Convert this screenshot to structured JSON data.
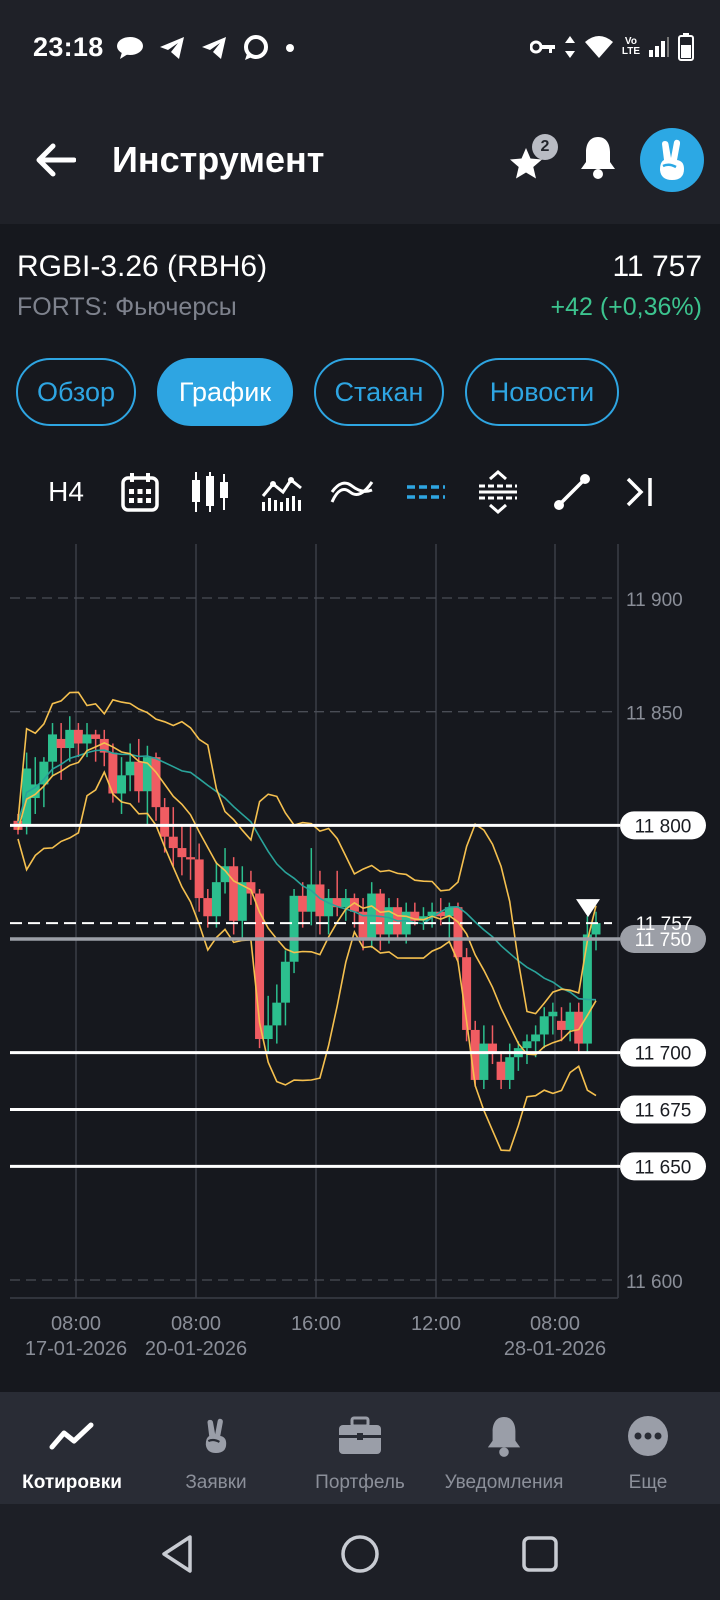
{
  "status_bar": {
    "time": "23:18",
    "volte_top": "Vo",
    "volte_bottom": "LTE"
  },
  "app_bar": {
    "title": "Инструмент",
    "favorites_count": "2"
  },
  "instrument": {
    "name": "RGBI-3.26 (RBH6)",
    "price": "11 757",
    "exchange": "FORTS: Фьючерсы",
    "change": "+42 (+0,36%)"
  },
  "tabs": [
    {
      "label": "Обзор",
      "active": false
    },
    {
      "label": "График",
      "active": true
    },
    {
      "label": "Стакан",
      "active": false
    },
    {
      "label": "Новости",
      "active": false
    }
  ],
  "toolbar": {
    "timeframe": "H4"
  },
  "colors": {
    "accent": "#2ea5e2",
    "bull": "#2cbf8e",
    "bear": "#f05c62",
    "bollinger": "#f5c04f",
    "moving_average": "#2aa49b",
    "positive": "#3cc48f"
  },
  "chart_data": {
    "type": "candlestick",
    "ylim": [
      11590,
      11920
    ],
    "y_ticks": [
      11900,
      11850,
      11600
    ],
    "x_tick_labels": [
      {
        "time": "08:00",
        "date": "17-01-2026"
      },
      {
        "time": "08:00",
        "date": "20-01-2026"
      },
      {
        "time": "16:00",
        "date": ""
      },
      {
        "time": "12:00",
        "date": ""
      },
      {
        "time": "08:00",
        "date": "28-01-2026"
      }
    ],
    "horizontal_levels": [
      11800,
      11700,
      11675,
      11650
    ],
    "current_price": 11757,
    "selected_level": 11750,
    "candles": [
      [
        11802,
        11805,
        11796,
        11798
      ],
      [
        11800,
        11832,
        11796,
        11825
      ],
      [
        11812,
        11830,
        11805,
        11818
      ],
      [
        11818,
        11830,
        11808,
        11828
      ],
      [
        11828,
        11845,
        11822,
        11840
      ],
      [
        11838,
        11845,
        11820,
        11834
      ],
      [
        11834,
        11848,
        11828,
        11842
      ],
      [
        11842,
        11845,
        11830,
        11836
      ],
      [
        11836,
        11845,
        11830,
        11840
      ],
      [
        11840,
        11842,
        11828,
        11838
      ],
      [
        11838,
        11842,
        11826,
        11832
      ],
      [
        11832,
        11836,
        11810,
        11814
      ],
      [
        11814,
        11830,
        11805,
        11822
      ],
      [
        11822,
        11836,
        11815,
        11828
      ],
      [
        11828,
        11838,
        11810,
        11815
      ],
      [
        11815,
        11835,
        11800,
        11830
      ],
      [
        11830,
        11832,
        11802,
        11808
      ],
      [
        11808,
        11812,
        11788,
        11795
      ],
      [
        11795,
        11808,
        11782,
        11790
      ],
      [
        11790,
        11800,
        11778,
        11786
      ],
      [
        11786,
        11800,
        11776,
        11785
      ],
      [
        11785,
        11792,
        11762,
        11768
      ],
      [
        11768,
        11772,
        11755,
        11760
      ],
      [
        11760,
        11784,
        11755,
        11775
      ],
      [
        11775,
        11790,
        11770,
        11782
      ],
      [
        11782,
        11786,
        11752,
        11758
      ],
      [
        11758,
        11782,
        11750,
        11775
      ],
      [
        11775,
        11780,
        11765,
        11770
      ],
      [
        11770,
        11772,
        11702,
        11706
      ],
      [
        11706,
        11725,
        11700,
        11712
      ],
      [
        11712,
        11730,
        11704,
        11722
      ],
      [
        11722,
        11745,
        11712,
        11740
      ],
      [
        11740,
        11772,
        11735,
        11769
      ],
      [
        11769,
        11775,
        11755,
        11762
      ],
      [
        11762,
        11790,
        11756,
        11774
      ],
      [
        11774,
        11780,
        11752,
        11760
      ],
      [
        11760,
        11772,
        11752,
        11768
      ],
      [
        11768,
        11780,
        11760,
        11764
      ],
      [
        11764,
        11772,
        11758,
        11768
      ],
      [
        11768,
        11770,
        11755,
        11762
      ],
      [
        11762,
        11768,
        11745,
        11750
      ],
      [
        11750,
        11775,
        11746,
        11770
      ],
      [
        11770,
        11772,
        11745,
        11752
      ],
      [
        11752,
        11768,
        11748,
        11764
      ],
      [
        11764,
        11768,
        11750,
        11752
      ],
      [
        11752,
        11766,
        11748,
        11762
      ],
      [
        11762,
        11766,
        11756,
        11758
      ],
      [
        11758,
        11764,
        11754,
        11760
      ],
      [
        11760,
        11766,
        11755,
        11762
      ],
      [
        11762,
        11768,
        11756,
        11760
      ],
      [
        11760,
        11766,
        11748,
        11764
      ],
      [
        11764,
        11766,
        11740,
        11742
      ],
      [
        11742,
        11746,
        11705,
        11710
      ],
      [
        11710,
        11714,
        11685,
        11688
      ],
      [
        11688,
        11712,
        11684,
        11704
      ],
      [
        11704,
        11712,
        11695,
        11700
      ],
      [
        11696,
        11700,
        11684,
        11688
      ],
      [
        11688,
        11704,
        11684,
        11698
      ],
      [
        11698,
        11705,
        11692,
        11702
      ],
      [
        11702,
        11708,
        11695,
        11705
      ],
      [
        11705,
        11712,
        11698,
        11708
      ],
      [
        11708,
        11720,
        11702,
        11716
      ],
      [
        11716,
        11722,
        11708,
        11718
      ],
      [
        11714,
        11720,
        11705,
        11710
      ],
      [
        11710,
        11722,
        11705,
        11718
      ],
      [
        11718,
        11722,
        11700,
        11704
      ],
      [
        11704,
        11760,
        11700,
        11752
      ],
      [
        11752,
        11762,
        11745,
        11757
      ]
    ]
  }
}
